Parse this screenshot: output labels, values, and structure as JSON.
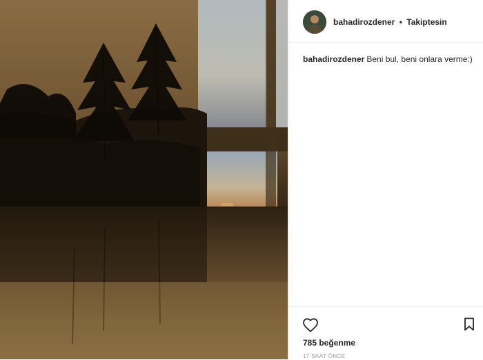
{
  "post": {
    "username": "bahadirozdener",
    "separator": "•",
    "follow_status": "Takiptesin",
    "caption_user": "bahadirozdener",
    "caption_text": "Beni bul, beni onlara verme:)",
    "likes_text": "785 beğenme",
    "timestamp": "17 SAAT ÖNCE"
  },
  "icons": {
    "like": "heart-outline-icon",
    "save": "bookmark-outline-icon"
  },
  "colors": {
    "text": "#262626",
    "muted": "#999999",
    "border": "#efefef"
  }
}
